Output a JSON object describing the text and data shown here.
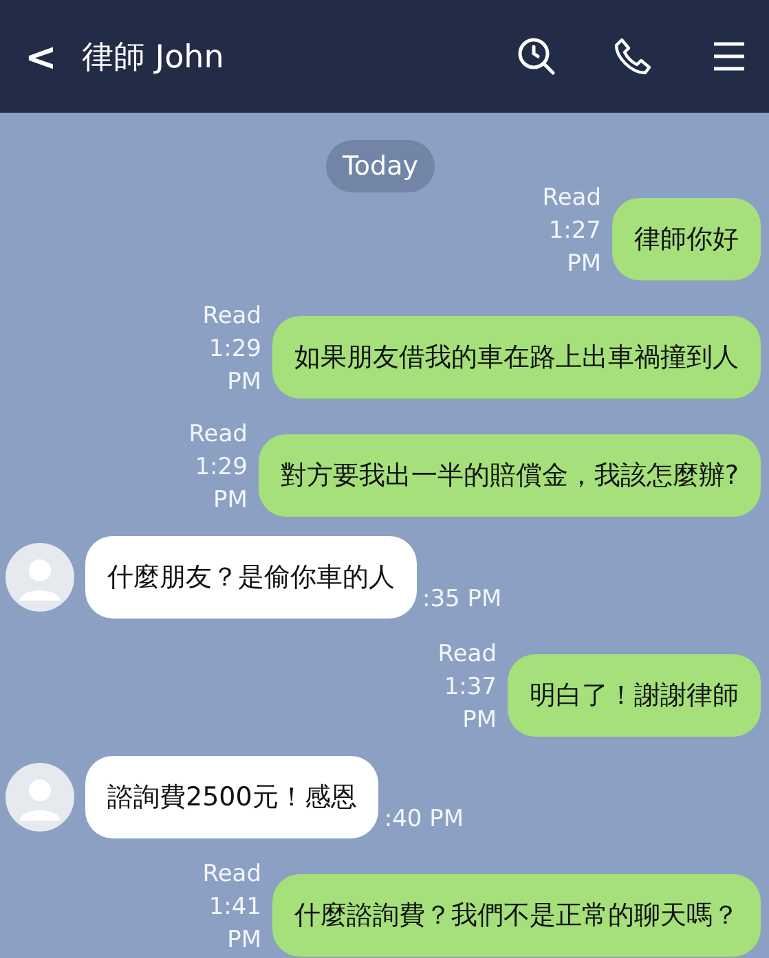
{
  "header": {
    "back": "<",
    "title": "律師 John"
  },
  "date_label": "Today",
  "messages": [
    {
      "kind": "sent",
      "text": "律師你好",
      "read": "Read",
      "time": "1:27 PM"
    },
    {
      "kind": "sent",
      "text": "如果朋友借我的車在路上出車禍撞到人",
      "read": "Read",
      "time": "1:29 PM"
    },
    {
      "kind": "sent",
      "text": "對方要我出一半的賠償金，我該怎麼辦?",
      "read": "Read",
      "time": "1:29 PM"
    },
    {
      "kind": "received",
      "text": "什麼朋友？是偷你車的人",
      "time": ":35 PM"
    },
    {
      "kind": "sent",
      "text": "明白了！謝謝律師",
      "read": "Read",
      "time": "1:37 PM"
    },
    {
      "kind": "received",
      "text": "諮詢費2500元！感恩",
      "time": ":40 PM"
    },
    {
      "kind": "sent",
      "text": "什麼諮詢費？我們不是正常的聊天嗎？",
      "read": "Read",
      "time": "1:41 PM"
    }
  ]
}
